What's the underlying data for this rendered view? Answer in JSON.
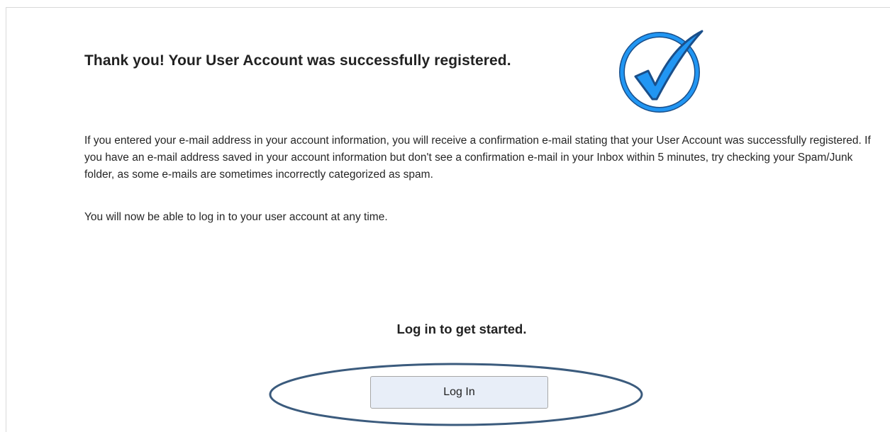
{
  "confirmation": {
    "title": "Thank you!  Your User Account was successfully registered.",
    "body": "If you entered your e-mail address in your account information, you will receive a confirmation e-mail stating that your User Account was successfully registered. If you have an e-mail address saved in your account information but don't see a confirmation e-mail in your Inbox within 5 minutes, try checking your Spam/Junk folder, as some e-mails are sometimes incorrectly categorized as spam.",
    "note": "You will now be able to log in to your user account at any time.",
    "icon": "checkmark-circle-icon"
  },
  "login": {
    "prompt": "Log in to get started.",
    "button_label": "Log In"
  },
  "colors": {
    "accent_blue": "#1e88e5",
    "icon_outline": "#1a4f8a",
    "highlight_ellipse": "#3b5b7d",
    "button_bg": "#e8eef8"
  }
}
